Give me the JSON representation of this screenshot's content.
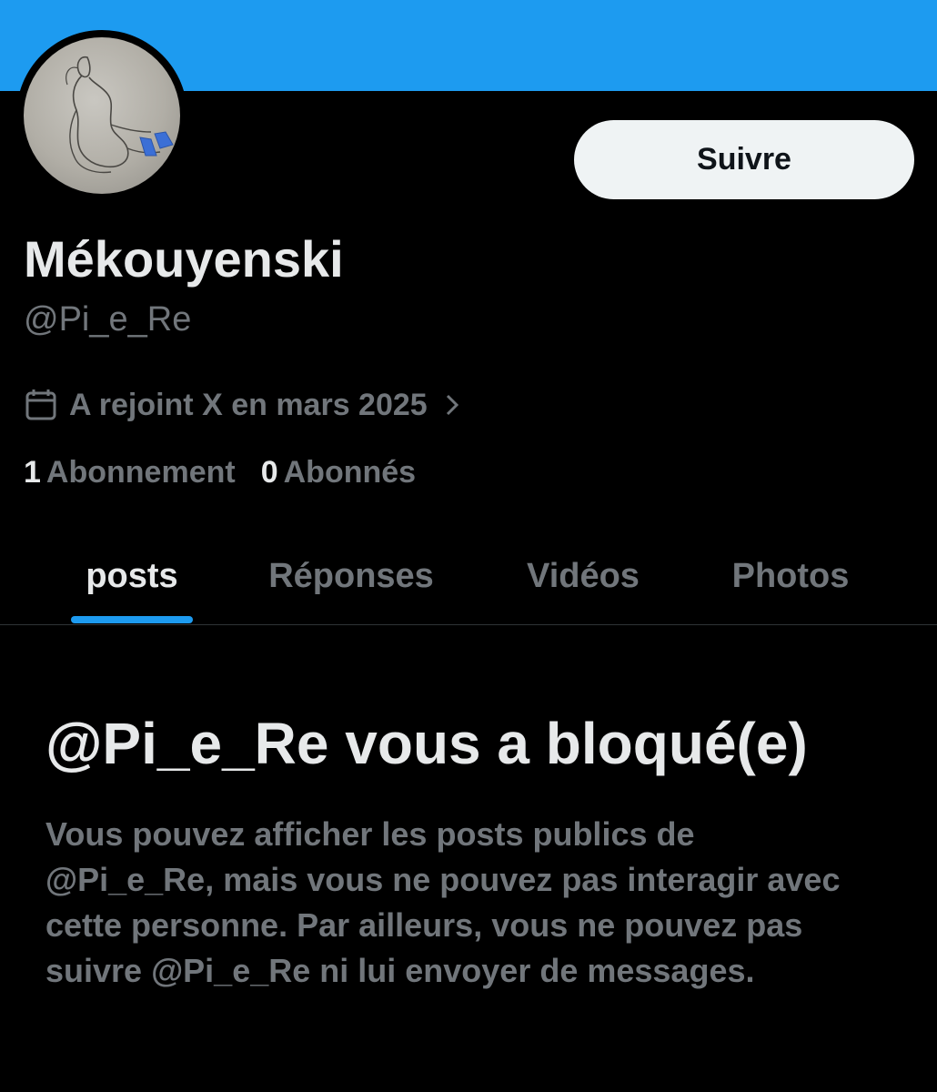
{
  "profile": {
    "display_name": "Mékouyenski",
    "handle": "@Pi_e_Re",
    "joined": "A rejoint X en mars 2025",
    "following_count": "1",
    "following_label": "Abonnement",
    "followers_count": "0",
    "followers_label": "Abonnés",
    "follow_label": "Suivre"
  },
  "tabs": [
    {
      "label": "posts",
      "active": true
    },
    {
      "label": "Réponses",
      "active": false
    },
    {
      "label": "Vidéos",
      "active": false
    },
    {
      "label": "Photos",
      "active": false
    }
  ],
  "blocked": {
    "title": "@Pi_e_Re vous a bloqué(e)",
    "description": "Vous pouvez afficher les posts publics de @Pi_e_Re, mais vous ne pouvez pas interagir avec cette personne. Par ailleurs, vous ne pouvez pas suivre @Pi_e_Re ni lui envoyer de messages."
  },
  "icons": {
    "joined": "calendar-icon",
    "joined_more": "chevron-right-icon"
  },
  "colors": {
    "banner": "#1d9bf0",
    "background": "#000000",
    "accent": "#1d9bf0",
    "text_primary": "#e7e9ea",
    "text_secondary": "#71767b",
    "follow_button_bg": "#eff3f4"
  }
}
